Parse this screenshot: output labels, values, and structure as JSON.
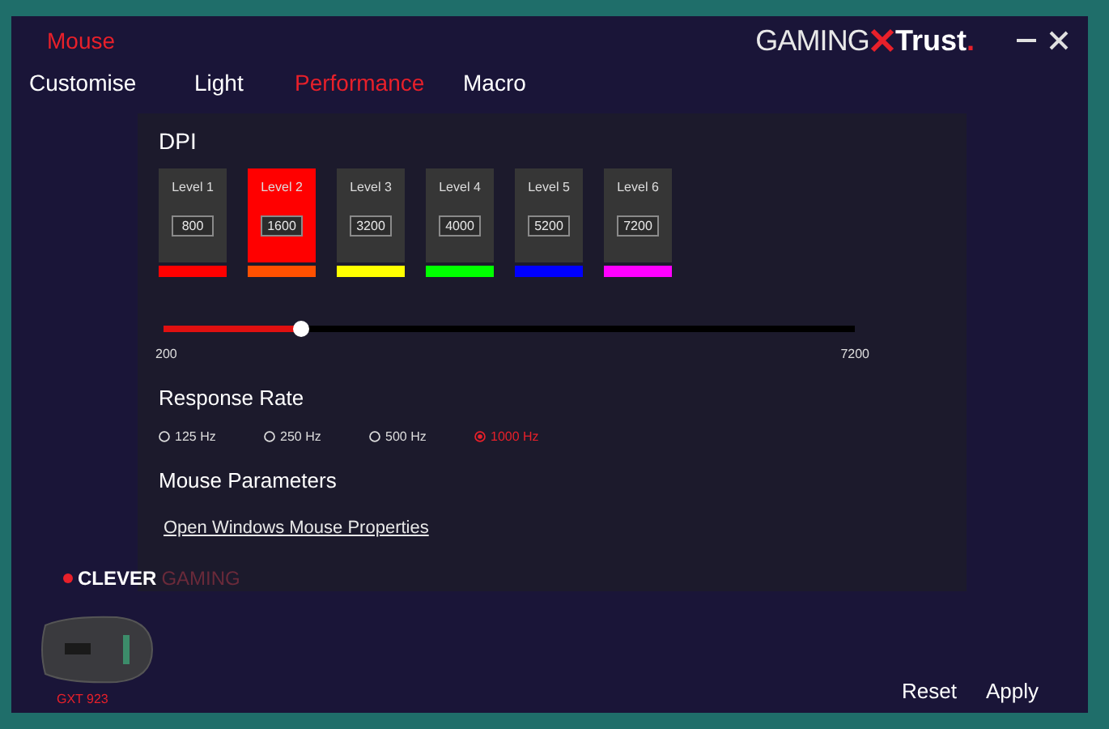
{
  "window": {
    "title": "Mouse",
    "logo": {
      "left": "GAMING",
      "right": "Trust",
      "dot": "."
    }
  },
  "tabs": [
    {
      "label": "Customise",
      "selected": false
    },
    {
      "label": "Light",
      "selected": false
    },
    {
      "label": "Performance",
      "selected": true
    },
    {
      "label": "Macro",
      "selected": false
    }
  ],
  "dpi": {
    "title": "DPI",
    "levels": [
      {
        "label": "Level 1",
        "value": "800",
        "selected": false,
        "color": "#ff0000"
      },
      {
        "label": "Level 2",
        "value": "1600",
        "selected": true,
        "color": "#ff5000"
      },
      {
        "label": "Level 3",
        "value": "3200",
        "selected": false,
        "color": "#ffff00"
      },
      {
        "label": "Level 4",
        "value": "4000",
        "selected": false,
        "color": "#00ff00"
      },
      {
        "label": "Level 5",
        "value": "5200",
        "selected": false,
        "color": "#0000ff"
      },
      {
        "label": "Level 6",
        "value": "7200",
        "selected": false,
        "color": "#ff00ff"
      }
    ],
    "slider": {
      "level": 0.2,
      "min": "200",
      "max": "7200"
    }
  },
  "response_rate": {
    "title": "Response Rate",
    "options": [
      {
        "label": "125 Hz",
        "selected": false
      },
      {
        "label": "250 Hz",
        "selected": false
      },
      {
        "label": "500 Hz",
        "selected": false
      },
      {
        "label": "1000 Hz",
        "selected": true
      }
    ]
  },
  "mouse_parameters": {
    "title": "Mouse Parameters",
    "link": "Open Windows Mouse Properties"
  },
  "brand": {
    "first": "CLEVER",
    "second": "GAMING"
  },
  "device": {
    "model": "GXT 923"
  },
  "buttons": [
    "Reset",
    "Apply"
  ]
}
